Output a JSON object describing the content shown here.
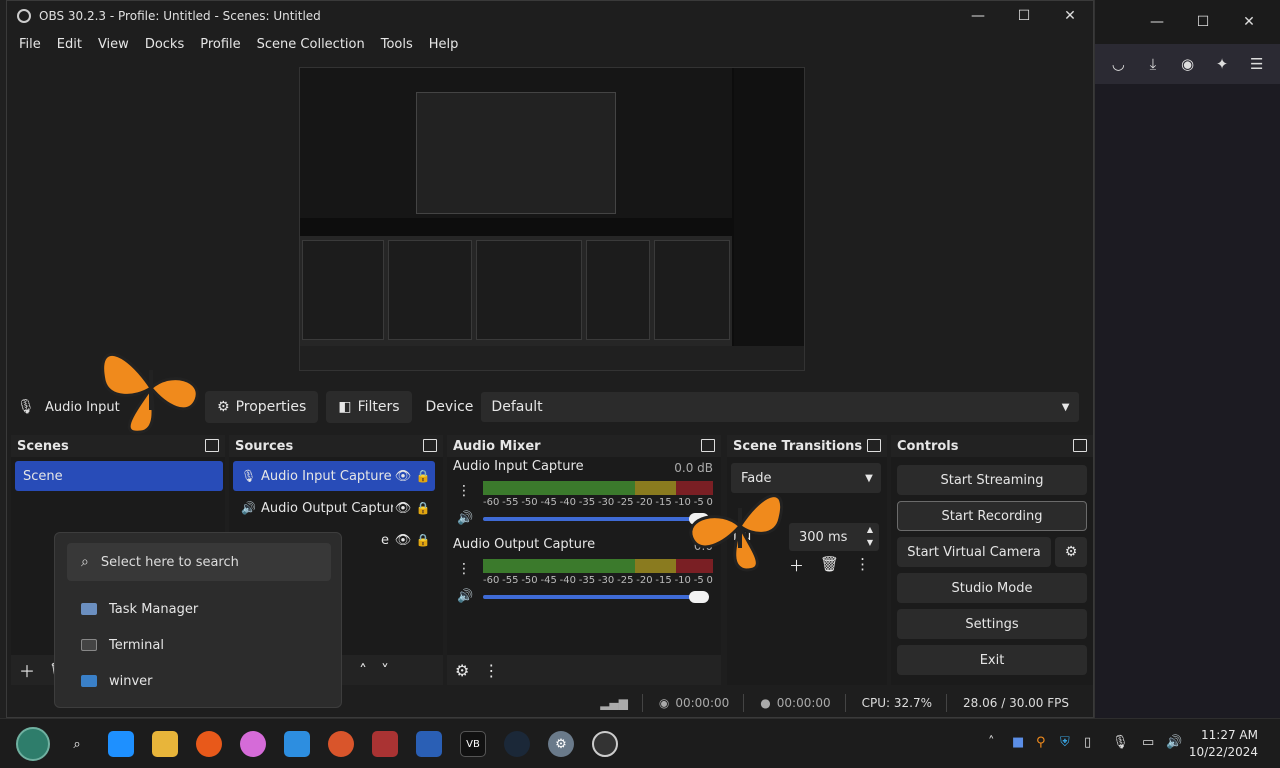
{
  "window": {
    "title": "OBS 30.2.3 - Profile: Untitled - Scenes: Untitled",
    "minimize": "—",
    "maximize": "☐",
    "close": "✕"
  },
  "menu": [
    "File",
    "Edit",
    "View",
    "Docks",
    "Profile",
    "Scene Collection",
    "Tools",
    "Help"
  ],
  "source_toolbar": {
    "source_name": "Audio Input",
    "properties_label": "Properties",
    "filters_label": "Filters",
    "device_label": "Device",
    "device_value": "Default"
  },
  "scenes": {
    "header": "Scenes",
    "items": [
      "Scene"
    ]
  },
  "sources": {
    "header": "Sources",
    "items": [
      {
        "label": "Audio Input Capture"
      },
      {
        "label": "Audio Output Captur"
      },
      {
        "label": "e"
      }
    ]
  },
  "mixer": {
    "header": "Audio Mixer",
    "channels": [
      {
        "name": "Audio Input Capture",
        "db": "0.0 dB",
        "volume": 1.0
      },
      {
        "name": "Audio Output Capture",
        "db": "0.0",
        "volume": 1.0
      }
    ],
    "ticks": [
      "-60",
      "-55",
      "-50",
      "-45",
      "-40",
      "-35",
      "-30",
      "-25",
      "-20",
      "-15",
      "-10",
      "-5",
      "0"
    ]
  },
  "transitions": {
    "header": "Scene Transitions",
    "selected": "Fade",
    "duration_label": "Du",
    "duration_value": "300 ms"
  },
  "controls": {
    "header": "Controls",
    "start_streaming": "Start Streaming",
    "start_recording": "Start Recording",
    "start_virtual_camera": "Start Virtual Camera",
    "studio_mode": "Studio Mode",
    "settings": "Settings",
    "exit": "Exit"
  },
  "status": {
    "stream_time": "00:00:00",
    "record_time": "00:00:00",
    "cpu": "CPU: 32.7%",
    "fps": "28.06 / 30.00 FPS"
  },
  "popup": {
    "search_placeholder": "Select here to search",
    "items": [
      "Task Manager",
      "Terminal",
      "winver"
    ]
  },
  "clock": {
    "time": "11:27 AM",
    "date": "10/22/2024"
  },
  "colors": {
    "selection": "#284cb8",
    "meter_green": "#3b7a2c",
    "meter_yellow": "#8a7b1f",
    "meter_red": "#7a1f24",
    "slider": "#3f6bd6"
  }
}
